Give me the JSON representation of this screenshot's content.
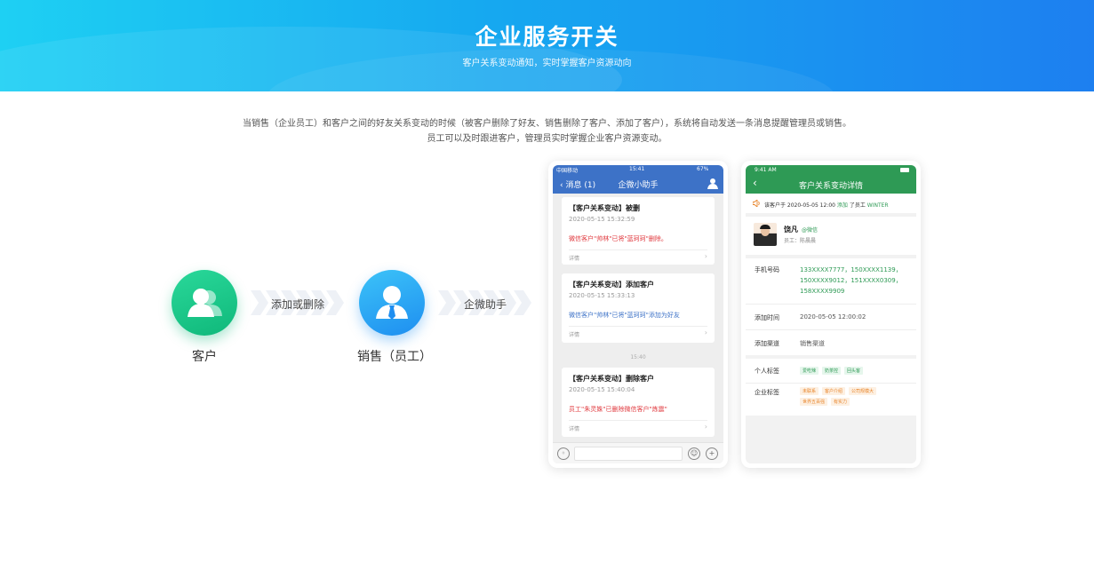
{
  "banner": {
    "title": "企业服务开关",
    "subtitle": "客户关系变动通知，实时掌握客户资源动向"
  },
  "description": {
    "line1": "当销售（企业员工）和客户之间的好友关系变动的时候（被客户删除了好友、销售删除了客户、添加了客户），系统将自动发送一条消息提醒管理员或销售。",
    "line2": "员工可以及时跟进客户，管理员实时掌握企业客户资源变动。"
  },
  "flow": {
    "customer_label": "客户",
    "step1_label": "添加或删除",
    "sales_label": "销售（员工）",
    "step2_label": "企微助手"
  },
  "phone1": {
    "status_carrier": "中国移动",
    "status_time": "15:41",
    "status_battery": "67%",
    "nav_back": "消息 (1)",
    "nav_title": "企微小助手",
    "messages": [
      {
        "title": "【客户关系变动】被删",
        "date": "2020-05-15 15:32:59",
        "body": "微信客户\"帅林\"已将\"蓝珂珂\"删除。",
        "footer": "详情"
      },
      {
        "title": "【客户关系变动】添加客户",
        "date": "2020-05-15 15:33:13",
        "body": "微信客户\"帅林\"已将\"蓝珂珂\"添加为好友",
        "footer": "详情"
      },
      {
        "title": "【客户关系变动】删除客户",
        "date": "2020-05-15 15:40:04",
        "body": "员工\"朱灵姝\"已删除微信客户\"炼震\"",
        "footer": "详情"
      }
    ],
    "time_separator": "15:40"
  },
  "phone2": {
    "status_time": "9:41 AM",
    "nav_title": "客户关系变动详情",
    "notice_prefix": "该客户于 2020-05-05 12:00",
    "notice_action": "添加",
    "notice_mid": "了员工",
    "notice_employee": "WINTER",
    "profile_name": "饶凡",
    "profile_tag": "@微信",
    "profile_employee": "员工：陈晨晨",
    "phone_label": "手机号码",
    "phone_value": "133XXXX7777，150XXXX1139，150XXXX9012，151XXXX0309，158XXXX9909",
    "add_time_label": "添加时间",
    "add_time_value": "2020-05-05 12:00:02",
    "channel_label": "添加渠道",
    "channel_value": "销售渠道",
    "personal_tags_label": "个人标签",
    "personal_tags": [
      "爱吃辣",
      "奶茶控",
      "回头客"
    ],
    "company_tags_label": "企业标签",
    "company_tags": [
      "未联系",
      "客户介绍",
      "公司规模大",
      "世界五百强",
      "有实力"
    ]
  },
  "colors": {
    "banner_start": "#1ed0f3",
    "banner_end": "#1d7ff0",
    "customer_node": "#0fb87a",
    "sales_node": "#1e8ef0",
    "wework_nav": "#3d72c7",
    "wechat_nav": "#2e9a55",
    "alert_red": "#e0393e"
  }
}
